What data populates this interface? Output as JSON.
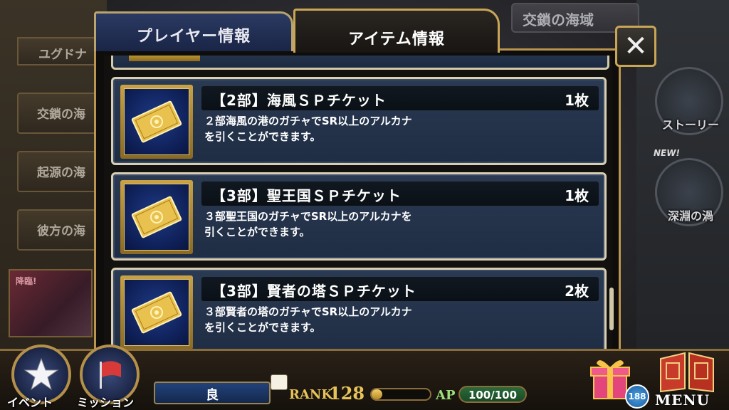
{
  "background": {
    "left_top_label": "ユグドナ",
    "left_menu": [
      "交鎖の海",
      "起源の海",
      "彼方の海"
    ],
    "event_banner_text": "降臨!",
    "right_title": "交鎖の海域",
    "right_items": [
      "ストーリー",
      "深淵の渦"
    ],
    "new_label": "NEW!"
  },
  "tabs": {
    "player": "プレイヤー情報",
    "item": "アイテム情報"
  },
  "close_label": "✕",
  "items": [
    {
      "name": "【2部】海風ＳＰチケット",
      "count": "1枚",
      "description": "２部海風の港のガチャでSR以上のアルカナ\nを引くことができます。",
      "icon": "golden-ticket-icon"
    },
    {
      "name": "【3部】聖王国ＳＰチケット",
      "count": "1枚",
      "description": "３部聖王国のガチャでSR以上のアルカナを\n引くことができます。",
      "icon": "golden-ticket-icon"
    },
    {
      "name": "【3部】賢者の塔ＳＰチケット",
      "count": "2枚",
      "description": "３部賢者の塔のガチャでSR以上のアルカナ\nを引くことができます。",
      "icon": "golden-ticket-icon"
    }
  ],
  "hud": {
    "event_label": "イベント",
    "mission_label": "ミッション",
    "player_name": "良",
    "rank_label": "RANK",
    "rank_value": "128",
    "ap_label": "AP",
    "ap_value": "100/100",
    "badge_count": "188",
    "menu_label": "MENU"
  },
  "colors": {
    "gold": "#c9a556",
    "item_bg": "#2a3a52",
    "tab_player": "#2b3a63"
  }
}
